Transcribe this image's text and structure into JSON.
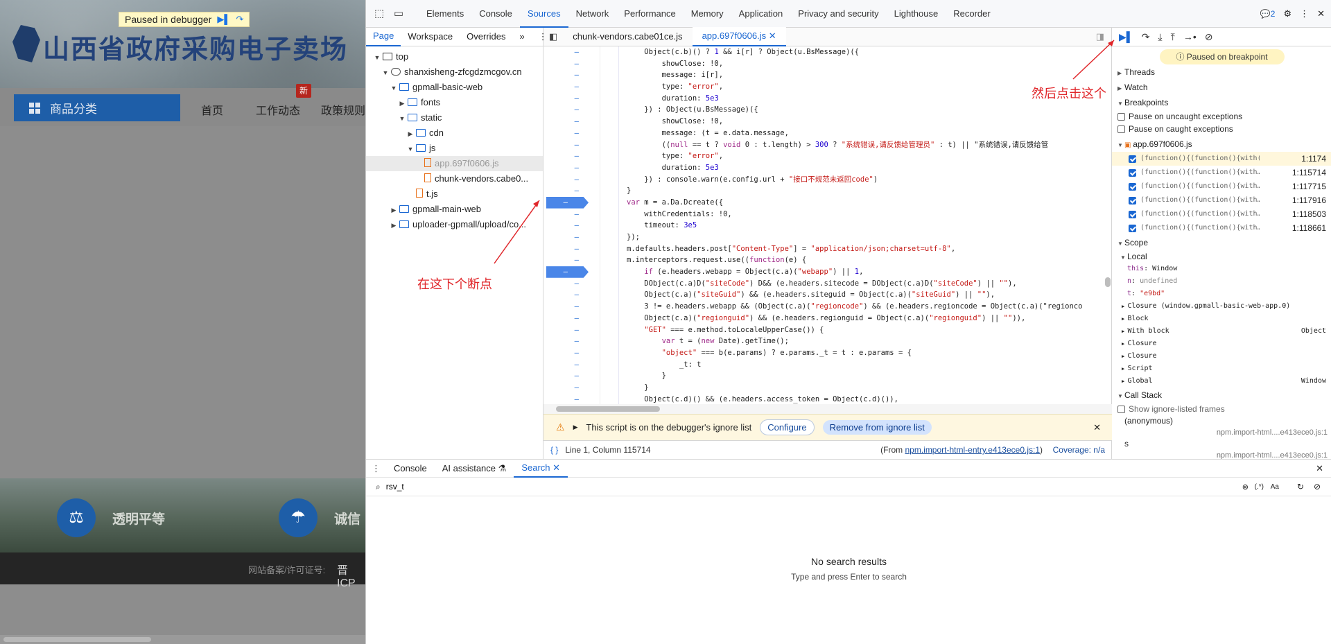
{
  "website": {
    "paused_label": "Paused in debugger",
    "title": "山西省政府采购电子卖场",
    "category_button": "商品分类",
    "nav": [
      "首页",
      "工作动态",
      "政策规则"
    ],
    "new_badge": "新",
    "features": [
      "透明平等",
      "诚信"
    ],
    "footer_label": "网站备案/许可证号:",
    "footer_value": "晋ICP"
  },
  "devtools": {
    "tabs": [
      "Elements",
      "Console",
      "Sources",
      "Network",
      "Performance",
      "Memory",
      "Application",
      "Privacy and security",
      "Lighthouse",
      "Recorder"
    ],
    "active_tab": "Sources",
    "message_count": "2",
    "navigator": {
      "tabs": [
        "Page",
        "Workspace",
        "Overrides"
      ],
      "tree": [
        {
          "label": "top",
          "depth": 0,
          "icon": "frame-icon",
          "arrow": "▼"
        },
        {
          "label": "shanxisheng-zfcgdzmcgov.cn",
          "depth": 1,
          "icon": "cloud-icon",
          "arrow": "▼"
        },
        {
          "label": "gpmall-basic-web",
          "depth": 2,
          "icon": "folder-icon",
          "arrow": "▼"
        },
        {
          "label": "fonts",
          "depth": 3,
          "icon": "folder-icon",
          "arrow": "▶"
        },
        {
          "label": "static",
          "depth": 3,
          "icon": "folder-icon",
          "arrow": "▼"
        },
        {
          "label": "cdn",
          "depth": 4,
          "icon": "folder-icon",
          "arrow": "▶"
        },
        {
          "label": "js",
          "depth": 4,
          "icon": "folder-icon",
          "arrow": "▼"
        },
        {
          "label": "app.697f0606.js",
          "depth": 5,
          "icon": "file-icon",
          "arrow": "",
          "selected": true
        },
        {
          "label": "chunk-vendors.cabe0...",
          "depth": 5,
          "icon": "file-icon",
          "arrow": ""
        },
        {
          "label": "t.js",
          "depth": 4,
          "icon": "file-icon",
          "arrow": ""
        },
        {
          "label": "gpmall-main-web",
          "depth": 2,
          "icon": "folder-icon",
          "arrow": "▶"
        },
        {
          "label": "uploader-gpmall/upload/co...",
          "depth": 2,
          "icon": "folder-icon",
          "arrow": "▶"
        }
      ]
    },
    "editor": {
      "file_tabs": [
        "chunk-vendors.cabe01ce.js",
        "app.697f0606.js"
      ],
      "active_file": "app.697f0606.js",
      "code_lines": [
        "    Object(c.b)() ? 1 && i[r] ? Object(u.BsMessage)({",
        "        showClose: !0,",
        "        message: i[r],",
        "        type: \"error\",",
        "        duration: 5e3",
        "    }) : Object(u.BsMessage)({",
        "        showClose: !0,",
        "        message: (t = e.data.message,",
        "        ((null == t ? void 0 : t.length) > 300 ? \"系统错误,请反馈给管理员\" : t) || \"系统错误,请反馈给管",
        "        type: \"error\",",
        "        duration: 5e3",
        "    }) : console.warn(e.config.url + \"接口不规范未返回code\")",
        "}",
        "var m = a.Da.Dcreate({",
        "    withCredentials: !0,",
        "    timeout: 3e5",
        "});",
        "m.defaults.headers.post[\"Content-Type\"] = \"application/json;charset=utf-8\",",
        "m.interceptors.request.use((function(e) {",
        "    if (e.headers.webapp = Object(c.a)(\"webapp\") || 1,",
        "    DObject(c.a)D(\"siteCode\") D&& (e.headers.sitecode = DObject(c.a)D(\"siteCode\") || \"\"),",
        "    Object(c.a)(\"siteGuid\") && (e.headers.siteguid = Object(c.a)(\"siteGuid\") || \"\"),",
        "    3 != e.headers.webapp && (Object(c.a)(\"regioncode\") && (e.headers.regioncode = Object(c.a)(\"regionco",
        "    Object(c.a)(\"regionguid\") && (e.headers.regionguid = Object(c.a)(\"regionguid\") || \"\")),",
        "    \"GET\" === e.method.toLocaleUpperCase()) {",
        "        var t = (new Date).getTime();",
        "        \"object\" === b(e.params) ? e.params._t = t : e.params = {",
        "            _t: t",
        "        }",
        "    }",
        "    Object(c.d)() && (e.headers.access_token = Object(c.d)()),"
      ],
      "breakpoint_lines": [
        13,
        19
      ],
      "ignore_bar": {
        "message": "This script is on the debugger's ignore list",
        "configure": "Configure",
        "remove": "Remove from ignore list"
      },
      "status": {
        "position": "Line 1, Column 115714",
        "from_prefix": "(From ",
        "from_link": "npm.import-html-entry.e413ece0.js:1",
        "from_suffix": ")",
        "coverage": "Coverage: n/a"
      }
    },
    "debugger": {
      "paused": "Paused on breakpoint",
      "threads": "Threads",
      "watch": "Watch",
      "breakpoints": "Breakpoints",
      "pause_uncaught": "Pause on uncaught exceptions",
      "pause_caught": "Pause on caught exceptions",
      "bp_file": "app.697f0606.js",
      "bp_list": [
        {
          "expr": "(function(){(function(){with(th…",
          "pos": "1:1174",
          "hit": true
        },
        {
          "expr": "(function(){(function(){with…",
          "pos": "1:115714"
        },
        {
          "expr": "(function(){(function(){with…",
          "pos": "1:117715"
        },
        {
          "expr": "(function(){(function(){with…",
          "pos": "1:117916"
        },
        {
          "expr": "(function(){(function(){with…",
          "pos": "1:118503"
        },
        {
          "expr": "(function(){(function(){with…",
          "pos": "1:118661"
        }
      ],
      "scope": "Scope",
      "local": "Local",
      "locals": [
        {
          "key": "this",
          "val": "Window",
          "type": "plain"
        },
        {
          "key": "n",
          "val": "undefined",
          "type": "und"
        },
        {
          "key": "t",
          "val": "\"e9bd\"",
          "type": "str"
        }
      ],
      "closures": [
        {
          "label": "Closure (window.gpmall-basic-web-app.0)",
          "val": ""
        },
        {
          "label": "Block",
          "val": ""
        },
        {
          "label": "With block",
          "val": "Object"
        },
        {
          "label": "Closure",
          "val": ""
        },
        {
          "label": "Closure",
          "val": ""
        },
        {
          "label": "Script",
          "val": ""
        },
        {
          "label": "Global",
          "val": "Window"
        }
      ],
      "call_stack": "Call Stack",
      "show_ignored": "Show ignore-listed frames",
      "frames": [
        {
          "name": "(anonymous)",
          "loc": "npm.import-html....e413ece0.js:1"
        },
        {
          "name": "s",
          "loc": "npm.import-html....e413ece0.js:1"
        }
      ]
    },
    "drawer": {
      "tabs": [
        "Console",
        "AI assistance",
        "Search"
      ],
      "active": "Search",
      "query": "rsv_t",
      "match_case": "Aa",
      "regex": "(.*)",
      "no_results": "No search results",
      "hint": "Type and press Enter to search"
    }
  },
  "annotations": {
    "set_breakpoint": "在这下个断点",
    "then_click": "然后点击这个"
  }
}
